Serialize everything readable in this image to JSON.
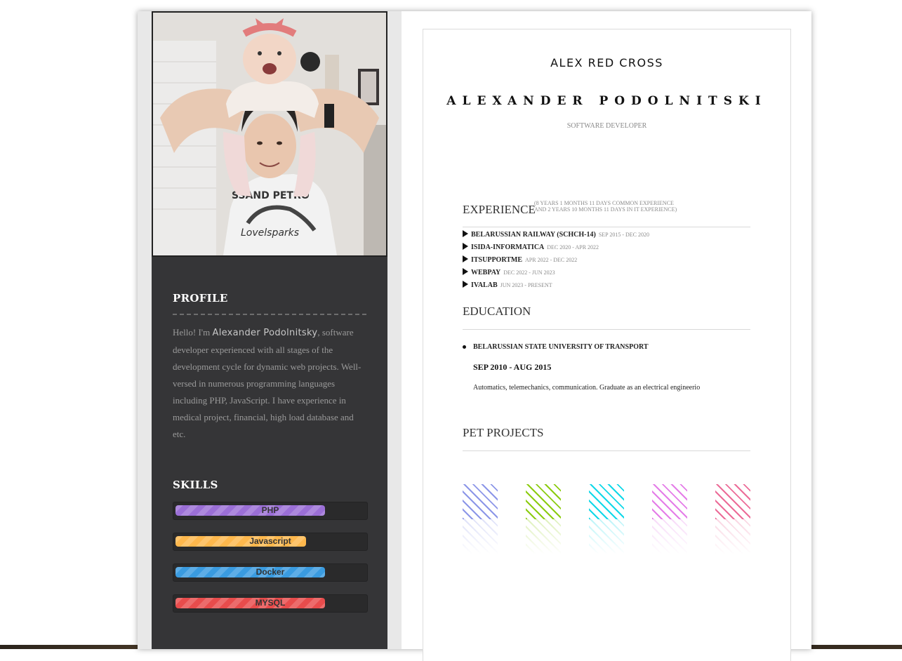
{
  "sidebar": {
    "profile_title": "PROFILE",
    "profile_intro": "Hello! I'm ",
    "profile_name": "Alexander Podolnitsky",
    "profile_rest": ", software developer experienced with all stages of the development cycle for dynamic web projects. Well-versed in numerous programming languages including PHP, JavaScript. I have experience in medical project, financial, high load database and etc.",
    "skills_title": "SKILLS",
    "skills": [
      {
        "name": "PHP",
        "level": 0.79,
        "color": "#9b6fd6"
      },
      {
        "name": "Javascript",
        "level": 0.69,
        "color": "#ffb84d"
      },
      {
        "name": "Docker",
        "level": 0.79,
        "color": "#3a9be0"
      },
      {
        "name": "MYSQL",
        "level": 0.79,
        "color": "#e84c4c"
      }
    ]
  },
  "header": {
    "logo": "ALEX RED CROSS",
    "name": "ALEXANDER PODOLNITSKI",
    "role": "SOFTWARE DEVELOPER"
  },
  "experience": {
    "title": "EXPERIENCE",
    "note_line1": "(8 YEARS 1 MONTHS 11 DAYS COMMON EXPERIENCE",
    "note_line2": "AND 2 YEARS 10 MONTHS 11 DAYS IN IT EXPERIENCE)",
    "jobs": [
      {
        "company": "BELARUSSIAN RAILWAY (SCHCH-14)",
        "dates": "SEP 2015 - DEC 2020"
      },
      {
        "company": "ISIDA-INFORMATICA",
        "dates": "DEC 2020 - APR 2022"
      },
      {
        "company": "ITSUPPORTME",
        "dates": "APR 2022 - DEC 2022"
      },
      {
        "company": "WEBPAY",
        "dates": "DEC 2022 - JUN 2023"
      },
      {
        "company": "IVALAB",
        "dates": "JUN 2023 - PRESENT"
      }
    ]
  },
  "education": {
    "title": "EDUCATION",
    "school": "BELARUSSIAN STATE UNIVERSITY OF TRANSPORT",
    "dates": "SEP 2010 - AUG 2015",
    "description": "Automatics, telemechanics, communication. Graduate as an electrical engineerio"
  },
  "projects": {
    "title": "PET PROJECTS",
    "tiles": [
      {
        "color": "#8c96e8"
      },
      {
        "color": "#8ccc10"
      },
      {
        "color": "#10d8e8"
      },
      {
        "color": "#e47ce8"
      },
      {
        "color": "#ec6c98"
      }
    ]
  }
}
